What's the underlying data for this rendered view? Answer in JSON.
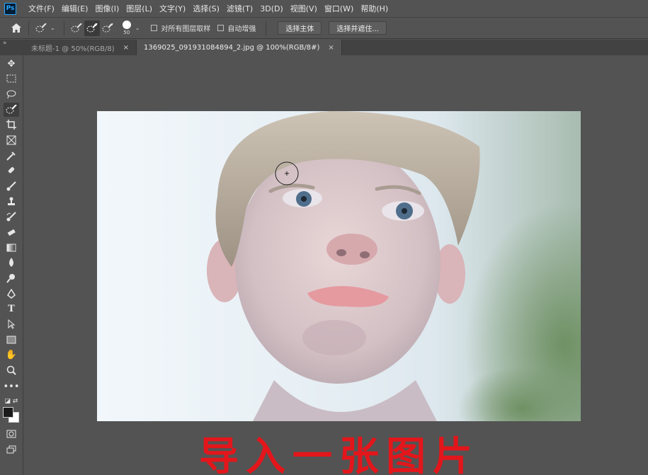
{
  "app": {
    "logo_text": "Ps"
  },
  "menu": [
    "文件(F)",
    "编辑(E)",
    "图像(I)",
    "图层(L)",
    "文字(Y)",
    "选择(S)",
    "滤镜(T)",
    "3D(D)",
    "视图(V)",
    "窗口(W)",
    "帮助(H)"
  ],
  "options": {
    "brush_size": "50",
    "sample_all_layers": "对所有图层取样",
    "auto_enhance": "自动增强",
    "select_subject": "选择主体",
    "select_and_mask": "选择并遮住..."
  },
  "tabs": [
    {
      "label": "未标题-1 @ 50%(RGB/8)",
      "close": "×"
    },
    {
      "label": "1369025_091931084894_2.jpg @ 100%(RGB/8#)",
      "close": "×"
    }
  ],
  "canvas": {
    "caption": "导入一张图片"
  },
  "colors": {
    "caption": "#e3161b",
    "ps_blue": "#31a8ff",
    "ui_bg": "#535353"
  },
  "icons": {
    "home": "home-icon",
    "quick_selection": "quick-selection-icon",
    "move": "move-icon"
  }
}
